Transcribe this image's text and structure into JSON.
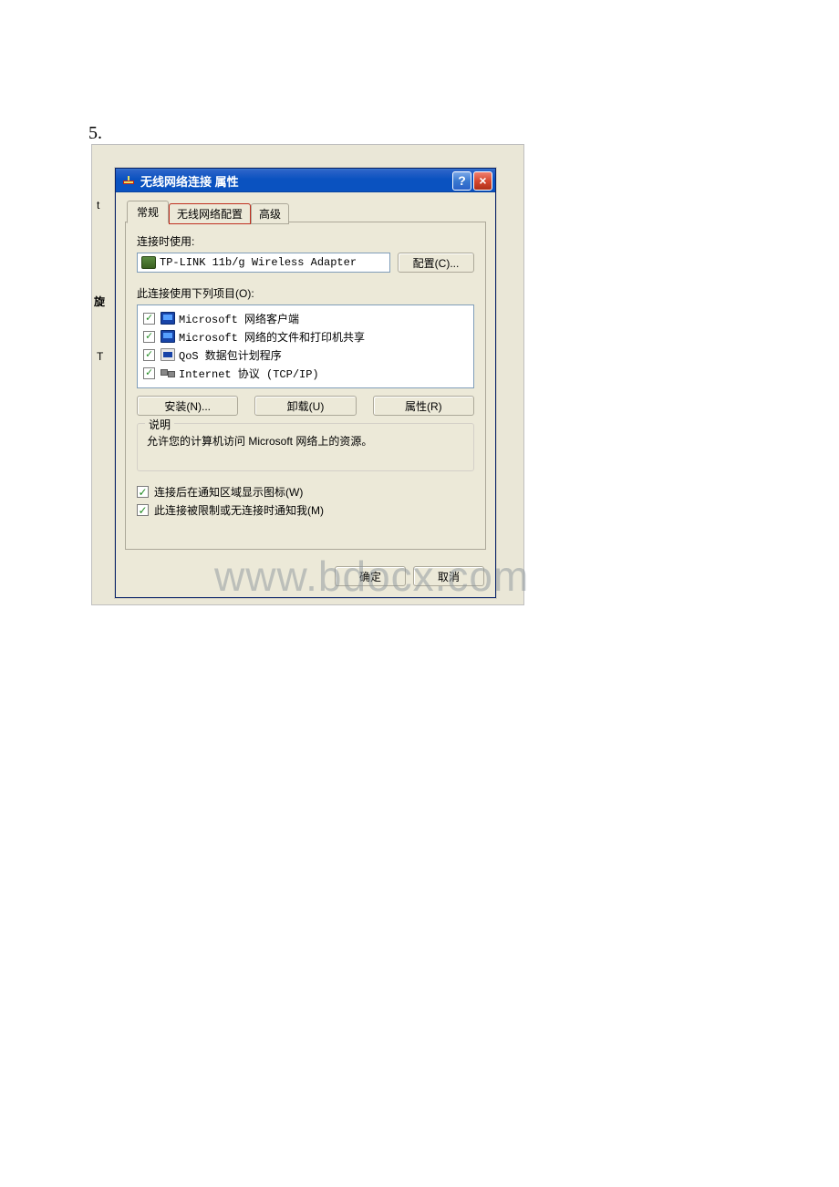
{
  "page_number": "5.",
  "window": {
    "title": "无线网络连接 属性",
    "help_glyph": "?",
    "close_glyph": "×"
  },
  "tabs": {
    "general": "常规",
    "wireless": "无线网络配置",
    "advanced": "高级"
  },
  "labels": {
    "connect_using": "连接时使用:",
    "adapter_name": "TP-LINK 11b/g Wireless Adapter",
    "configure_btn": "配置(C)...",
    "items_label": "此连接使用下列项目(O):",
    "install_btn": "安装(N)...",
    "uninstall_btn": "卸载(U)",
    "properties_btn": "属性(R)",
    "desc_legend": "说明",
    "desc_text": "允许您的计算机访问 Microsoft 网络上的资源。",
    "chk_show_icon": "连接后在通知区域显示图标(W)",
    "chk_notify": "此连接被限制或无连接时通知我(M)",
    "ok": "确定",
    "cancel": "取消"
  },
  "list": {
    "item1": "Microsoft 网络客户端",
    "item2": "Microsoft 网络的文件和打印机共享",
    "item3": "QoS 数据包计划程序",
    "item4": "Internet 协议 (TCP/IP)"
  },
  "watermark": "www.bdocx.com",
  "sidefrags": {
    "f1": "t",
    "f2": "旋",
    "f3": "T"
  }
}
